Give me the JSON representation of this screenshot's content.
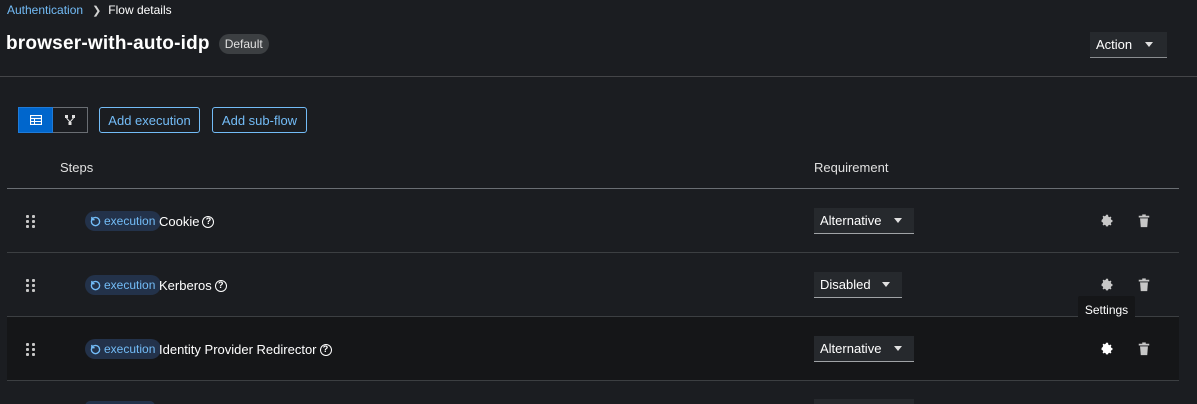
{
  "breadcrumb": {
    "parent": "Authentication",
    "current": "Flow details"
  },
  "header": {
    "title": "browser-with-auto-idp",
    "badge": "Default",
    "action_label": "Action"
  },
  "toolbar": {
    "table_view_icon": "table-icon",
    "diagram_view_icon": "diagram-icon",
    "add_execution": "Add execution",
    "add_subflow": "Add sub-flow"
  },
  "table": {
    "col_steps": "Steps",
    "col_requirement": "Requirement",
    "rows": [
      {
        "type": "execution",
        "name": "Cookie",
        "requirement": "Alternative"
      },
      {
        "type": "execution",
        "name": "Kerberos",
        "requirement": "Disabled"
      },
      {
        "type": "execution",
        "name": "Identity Provider Redirector",
        "requirement": "Alternative"
      }
    ]
  },
  "tooltip": "Settings",
  "colors": {
    "background": "#1b1d21",
    "accent": "#73bcf7",
    "primary": "#0066cc"
  }
}
